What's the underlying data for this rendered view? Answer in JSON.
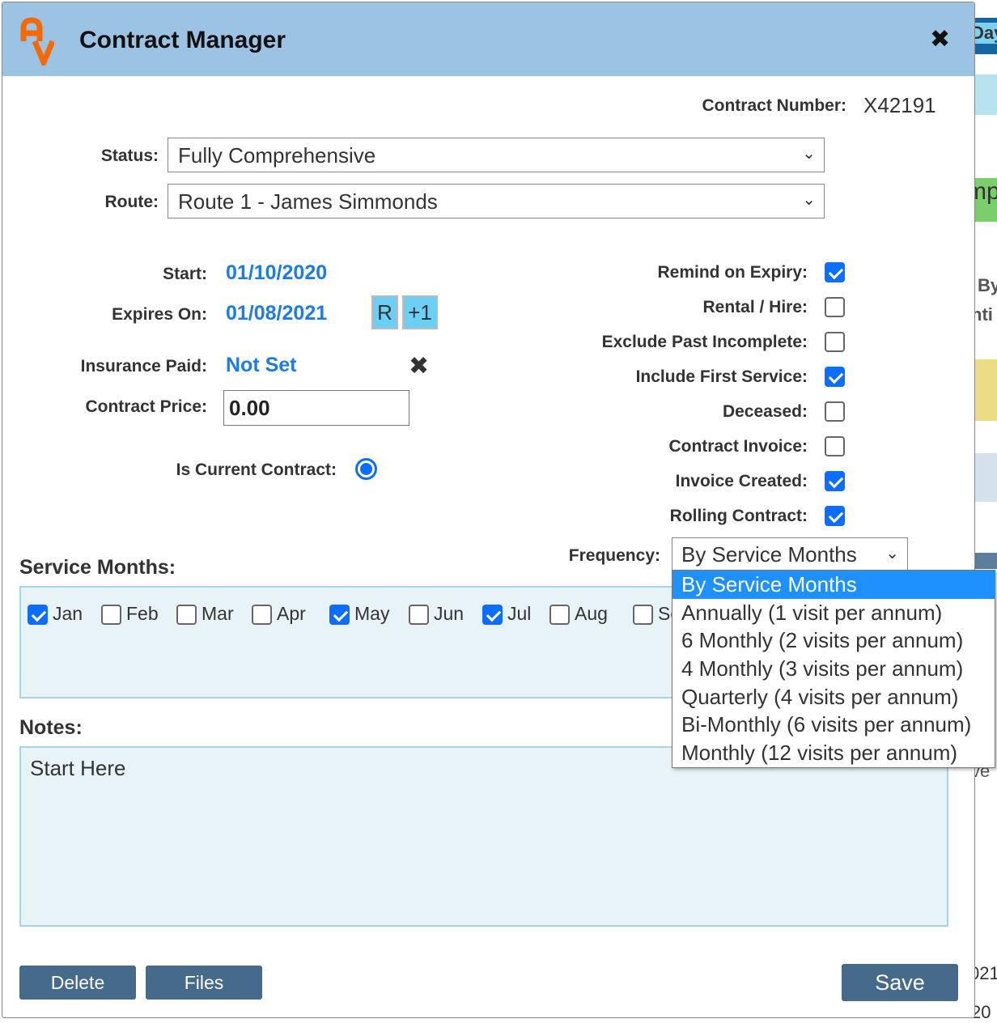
{
  "background": {
    "fragments": [
      "Day",
      "mp",
      "By",
      "nti",
      "ve",
      "021",
      "20"
    ]
  },
  "dialog": {
    "title": "Contract Manager",
    "contract_number_label": "Contract Number:",
    "contract_number": "X42191",
    "status_label": "Status:",
    "status_value": "Fully Comprehensive",
    "route_label": "Route:",
    "route_value": "Route 1 - James Simmonds",
    "start_label": "Start:",
    "start_value": "01/10/2020",
    "expires_label": "Expires On:",
    "expires_value": "01/08/2021",
    "r_button": "R",
    "plus1_button": "+1",
    "insurance_label": "Insurance Paid:",
    "insurance_value": "Not Set",
    "price_label": "Contract Price:",
    "price_value": "0.00",
    "current_label": "Is Current Contract:",
    "current_selected": true,
    "flags": [
      {
        "label": "Remind on Expiry:",
        "checked": true
      },
      {
        "label": "Rental / Hire:",
        "checked": false
      },
      {
        "label": "Exclude Past Incomplete:",
        "checked": false
      },
      {
        "label": "Include First Service:",
        "checked": true
      },
      {
        "label": "Deceased:",
        "checked": false
      },
      {
        "label": "Contract Invoice:",
        "checked": false
      },
      {
        "label": "Invoice Created:",
        "checked": true
      },
      {
        "label": "Rolling Contract:",
        "checked": true
      }
    ],
    "frequency_label": "Frequency:",
    "frequency_value": "By Service Months",
    "frequency_options": [
      "By Service Months",
      "Annually (1 visit per annum)",
      "6 Monthly (2 visits per annum)",
      "4 Monthly (3 visits per annum)",
      "Quarterly (4 visits per annum)",
      "Bi-Monthly (6 visits per annum)",
      "Monthly (12 visits per annum)"
    ],
    "service_months_label": "Service Months:",
    "months": [
      {
        "label": "Jan",
        "checked": true
      },
      {
        "label": "Feb",
        "checked": false
      },
      {
        "label": "Mar",
        "checked": false
      },
      {
        "label": "Apr",
        "checked": false
      },
      {
        "label": "May",
        "checked": true
      },
      {
        "label": "Jun",
        "checked": false
      },
      {
        "label": "Jul",
        "checked": true
      },
      {
        "label": "Aug",
        "checked": false
      },
      {
        "label": "Sep",
        "checked": false
      }
    ],
    "notes_label": "Notes:",
    "notes_value": "Start Here",
    "delete_button": "Delete",
    "files_button": "Files",
    "save_button": "Save",
    "colors": {
      "header": "#9cc3e4",
      "link": "#1e7be0",
      "button": "#466a8a",
      "highlight": "#1e90ff"
    }
  }
}
